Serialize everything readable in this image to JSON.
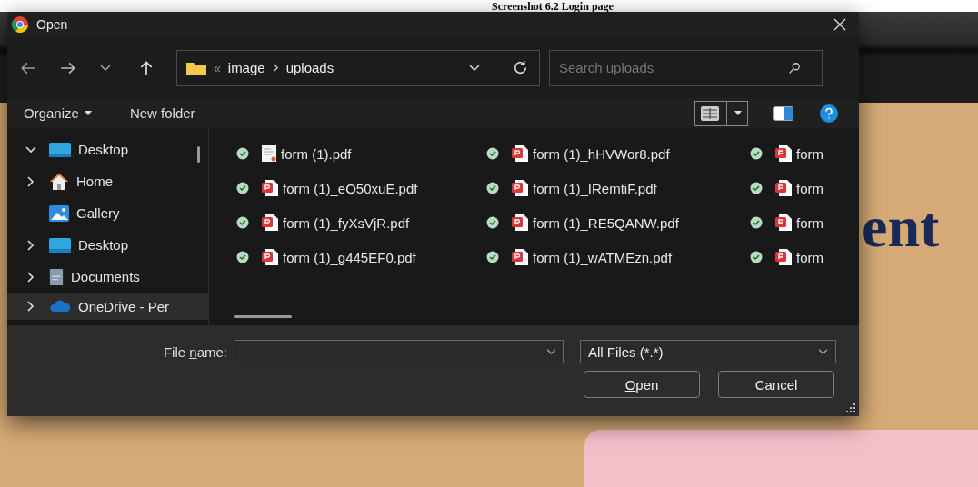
{
  "caption": "Screenshot 6.2 Login page",
  "background": {
    "heading_fragment": "ent"
  },
  "dialog": {
    "title": "Open",
    "path": {
      "overflow": "«",
      "segments": [
        "image",
        "uploads"
      ]
    },
    "search": {
      "placeholder": "Search uploads"
    },
    "toolbar": {
      "organize": "Organize",
      "new_folder": "New folder"
    },
    "nav": [
      {
        "label": "Desktop",
        "kind": "desktop",
        "has_children": true,
        "expanded": true,
        "selected": false
      },
      {
        "label": "Home",
        "kind": "home",
        "has_children": true,
        "expanded": false,
        "selected": false
      },
      {
        "label": "Gallery",
        "kind": "gallery",
        "has_children": false,
        "selected": false
      },
      {
        "label": "Desktop",
        "kind": "desktop",
        "has_children": true,
        "expanded": false,
        "selected": false
      },
      {
        "label": "Documents",
        "kind": "documents",
        "has_children": true,
        "expanded": false,
        "selected": false
      },
      {
        "label": "OneDrive - Per",
        "kind": "onedrive",
        "has_children": true,
        "expanded": false,
        "selected": true
      }
    ],
    "files": [
      {
        "name": "form  (1).pdf",
        "kind": "thumbnail"
      },
      {
        "name": "form  (1)_eO50xuE.pdf",
        "kind": "pdf"
      },
      {
        "name": "form  (1)_fyXsVjR.pdf",
        "kind": "pdf"
      },
      {
        "name": "form  (1)_g445EF0.pdf",
        "kind": "pdf"
      },
      {
        "name": "form  (1)_hHVWor8.pdf",
        "kind": "pdf"
      },
      {
        "name": "form  (1)_IRemtiF.pdf",
        "kind": "pdf"
      },
      {
        "name": "form  (1)_RE5QANW.pdf",
        "kind": "pdf"
      },
      {
        "name": "form  (1)_wATMEzn.pdf",
        "kind": "pdf"
      },
      {
        "name": "form",
        "kind": "pdf"
      },
      {
        "name": "form",
        "kind": "pdf"
      },
      {
        "name": "form",
        "kind": "pdf"
      },
      {
        "name": "form",
        "kind": "pdf"
      }
    ],
    "file_name": {
      "label": [
        {
          "text": "File ",
          "underline": false
        },
        {
          "text": "n",
          "underline": true
        },
        {
          "text": "ame:",
          "underline": false
        }
      ]
    },
    "filter": {
      "value": "All Files (*.*)"
    },
    "buttons": [
      {
        "label": [
          {
            "text": "O",
            "underline": true
          },
          {
            "text": "pen",
            "underline": false
          }
        ]
      },
      {
        "label": [
          {
            "text": "Cancel",
            "underline": false
          }
        ]
      }
    ]
  }
}
